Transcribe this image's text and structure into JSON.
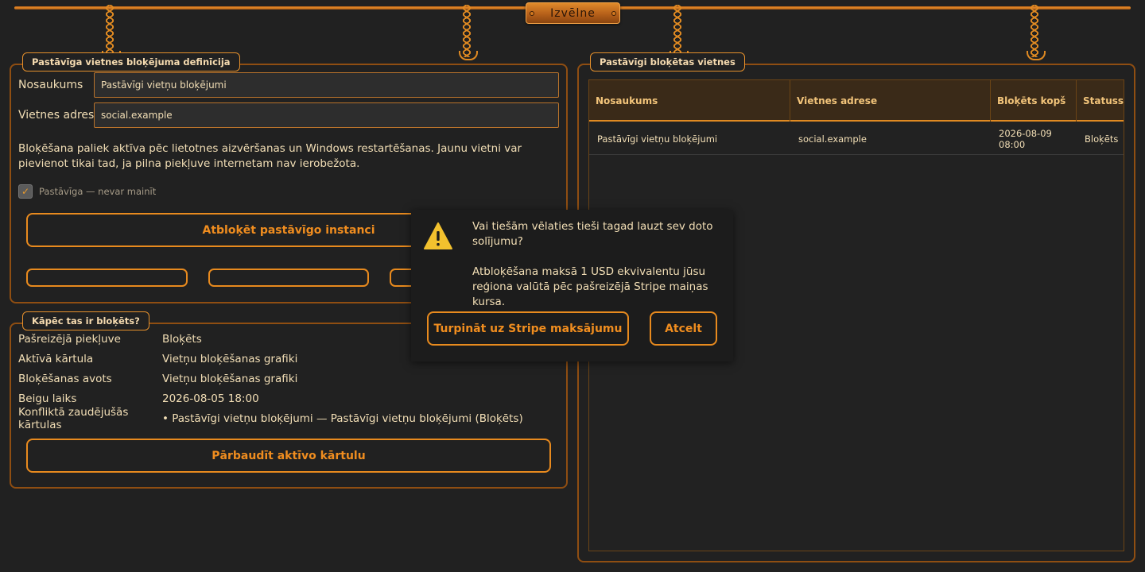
{
  "menu": {
    "label": "Izvēlne"
  },
  "definition_panel": {
    "legend": "Pastāvīga vietnes bloķējuma definīcija",
    "name_label": "Nosaukums",
    "name_value": "Pastāvīgi vietņu bloķējumi",
    "address_label": "Vietnes adrese",
    "address_value": "social.example",
    "description": "Bloķēšana paliek aktīva pēc lietotnes aizvēršanas un Windows restartēšanas. Jaunu vietni var pievienot tikai tad, ja pilna piekļuve internetam nav ierobežota.",
    "checkbox_label": "Pastāvīga — nevar mainīt",
    "unblock_button": "Atbloķēt pastāvīgo instanci"
  },
  "why_panel": {
    "legend": "Kāpēc tas ir bloķēts?",
    "rows": [
      {
        "key": "Pašreizējā piekļuve",
        "value": "Bloķēts"
      },
      {
        "key": "Aktīvā kārtula",
        "value": "Vietņu bloķēšanas grafiki"
      },
      {
        "key": "Bloķēšanas avots",
        "value": "Vietņu bloķēšanas grafiki"
      },
      {
        "key": "Beigu laiks",
        "value": "2026-08-05 18:00"
      },
      {
        "key": "Konfliktā zaudējušās kārtulas",
        "value": "• Pastāvīgi vietņu bloķējumi — Pastāvīgi vietņu bloķējumi (Bloķēts)"
      }
    ],
    "check_button": "Pārbaudīt aktīvo kārtulu"
  },
  "blocked_panel": {
    "legend": "Pastāvīgi bloķētas vietnes",
    "columns": [
      "Nosaukums",
      "Vietnes adrese",
      "Bloķēts kopš",
      "Statuss"
    ],
    "rows": [
      [
        "Pastāvīgi vietņu bloķējumi",
        "social.example",
        "2026-08-09 08:00",
        "Bloķēts"
      ]
    ]
  },
  "dialog": {
    "question": "Vai tiešām vēlaties tieši tagad lauzt sev doto solījumu?",
    "detail": "Atbloķēšana maksā 1 USD ekvivalentu jūsu reģiona valūtā pēc pašreizējā Stripe maiņas kursa.",
    "continue_button": "Turpināt uz Stripe maksājumu",
    "cancel_button": "Atcelt",
    "icon": "warning-icon"
  },
  "colors": {
    "accent": "#e88a1e",
    "background": "#212121",
    "text": "#f3dfb6"
  }
}
